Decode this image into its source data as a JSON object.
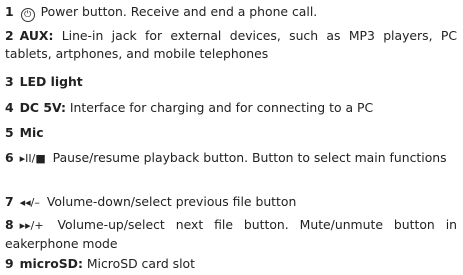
{
  "items": [
    {
      "num": "1",
      "icon": "power-icon",
      "icon_glyph": "⏻",
      "text": "Power button. Receive and end a phone call."
    },
    {
      "num": "2",
      "label": "AUX:",
      "text": " Line-in jack for external devices, such as MP3 players, PC tablets, artphones, and mobile telephones"
    },
    {
      "num": "3",
      "label": "LED light"
    },
    {
      "num": "4",
      "label": "DC 5V:",
      "text": " Interface for charging and for connecting to a PC"
    },
    {
      "num": "5",
      "label": "Mic"
    },
    {
      "num": "6",
      "icon": "play-pause-icon",
      "icon_glyph": "▸II/■",
      "text": " Pause/resume playback button. Button to select main functions"
    },
    {
      "num": "7",
      "icon": "rewind-icon",
      "icon_glyph": "◂◂/–",
      "text": " Volume-down/select previous file button"
    },
    {
      "num": "8",
      "icon": "fast-forward-icon",
      "icon_glyph": "▸▸/+",
      "text": " Volume-up/select next file button. Mute/unmute button in eakerphone mode"
    },
    {
      "num": "9",
      "label": "microSD:",
      "text": " MicroSD card slot"
    }
  ]
}
